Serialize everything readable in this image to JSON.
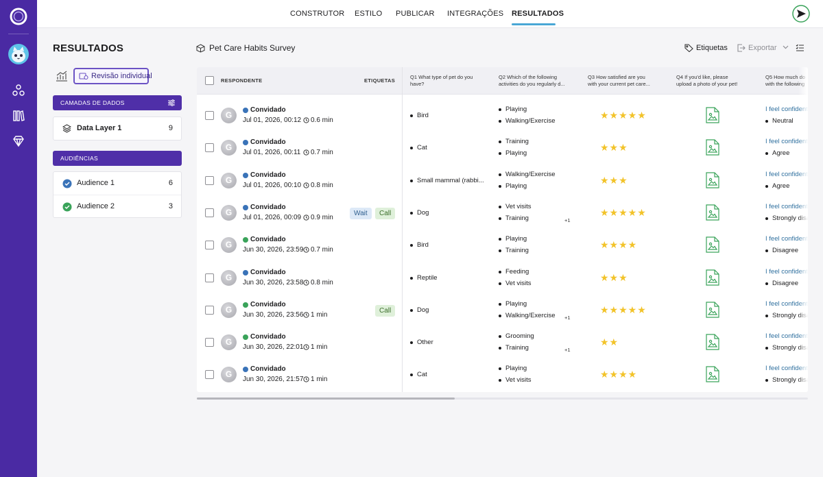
{
  "nav": {
    "tabs": [
      {
        "label": "CONSTRUTOR"
      },
      {
        "label": "ESTILO"
      },
      {
        "label": "PUBLICAR"
      },
      {
        "label": "INTEGRAÇÕES"
      },
      {
        "label": "RESULTADOS",
        "active": true
      }
    ]
  },
  "sidebar": {
    "title": "RESULTADOS",
    "review_button": "Revisão individual",
    "data_layers_header": "CAMADAS DE DADOS",
    "data_layers": [
      {
        "label": "Data Layer 1",
        "count": "9"
      }
    ],
    "audiences_header": "AUDIÊNCIAS",
    "audiences": [
      {
        "label": "Audience 1",
        "count": "6",
        "color": "#3a73b8"
      },
      {
        "label": "Audience 2",
        "count": "3",
        "color": "#3aa35a"
      }
    ]
  },
  "survey": {
    "title": "Pet Care Habits Survey"
  },
  "toolbar": {
    "tags_label": "Etiquetas",
    "export_label": "Exportar"
  },
  "table": {
    "headers": {
      "respondent": "RESPONDENTE",
      "tags": "ETIQUETAS",
      "q1": [
        "Q1 What type of pet do you",
        "have?"
      ],
      "q2": [
        "Q2 Which of the following",
        "activities do you regularly d..."
      ],
      "q3": [
        "Q3 How satisfied are you",
        "with your current pet care..."
      ],
      "q4": [
        "Q4 If you'd like, please",
        "upload a photo of your pet!"
      ],
      "q5": [
        "Q5 How much do",
        "with the following"
      ]
    },
    "rows": [
      {
        "name": "Convidado",
        "dot": "#3a73b8",
        "date": "Jul 01, 2026, 00:12",
        "time": "0.6 min",
        "tags": [],
        "q1": "Bird",
        "q2": [
          "Playing",
          "Walking/Exercise"
        ],
        "q2_more": "",
        "stars": 5,
        "q5_link": "I feel confident",
        "q5": "Neutral"
      },
      {
        "name": "Convidado",
        "dot": "#3a73b8",
        "date": "Jul 01, 2026, 00:11",
        "time": "0.7 min",
        "tags": [],
        "q1": "Cat",
        "q2": [
          "Training",
          "Playing"
        ],
        "q2_more": "",
        "stars": 3,
        "q5_link": "I feel confident",
        "q5": "Agree"
      },
      {
        "name": "Convidado",
        "dot": "#3a73b8",
        "date": "Jul 01, 2026, 00:10",
        "time": "0.8 min",
        "tags": [],
        "q1": "Small mammal (rabbi...",
        "q2": [
          "Walking/Exercise",
          "Playing"
        ],
        "q2_more": "",
        "stars": 3,
        "q5_link": "I feel confident",
        "q5": "Agree"
      },
      {
        "name": "Convidado",
        "dot": "#3a73b8",
        "date": "Jul 01, 2026, 00:09",
        "time": "0.9 min",
        "tags": [
          "Wait",
          "Call"
        ],
        "q1": "Dog",
        "q2": [
          "Vet visits",
          "Training"
        ],
        "q2_more": "+1",
        "stars": 5,
        "q5_link": "I feel confident",
        "q5": "Strongly disa"
      },
      {
        "name": "Convidado",
        "dot": "#3aa35a",
        "date": "Jun 30, 2026, 23:59",
        "time": "0.7 min",
        "tags": [],
        "q1": "Bird",
        "q2": [
          "Playing",
          "Training"
        ],
        "q2_more": "",
        "stars": 4,
        "q5_link": "I feel confident",
        "q5": "Disagree"
      },
      {
        "name": "Convidado",
        "dot": "#3a73b8",
        "date": "Jun 30, 2026, 23:58",
        "time": "0.8 min",
        "tags": [],
        "q1": "Reptile",
        "q2": [
          "Feeding",
          "Vet visits"
        ],
        "q2_more": "",
        "stars": 3,
        "q5_link": "I feel confident",
        "q5": "Disagree"
      },
      {
        "name": "Convidado",
        "dot": "#3aa35a",
        "date": "Jun 30, 2026, 23:56",
        "time": "1 min",
        "tags": [
          "Call"
        ],
        "q1": "Dog",
        "q2": [
          "Playing",
          "Walking/Exercise"
        ],
        "q2_more": "+1",
        "stars": 5,
        "q5_link": "I feel confident",
        "q5": "Strongly disa"
      },
      {
        "name": "Convidado",
        "dot": "#3aa35a",
        "date": "Jun 30, 2026, 22:01",
        "time": "1 min",
        "tags": [],
        "q1": "Other",
        "q2": [
          "Grooming",
          "Training"
        ],
        "q2_more": "+1",
        "stars": 2,
        "q5_link": "I feel confident",
        "q5": "Strongly disa"
      },
      {
        "name": "Convidado",
        "dot": "#3a73b8",
        "date": "Jun 30, 2026, 21:57",
        "time": "1 min",
        "tags": [],
        "q1": "Cat",
        "q2": [
          "Playing",
          "Vet visits"
        ],
        "q2_more": "",
        "stars": 4,
        "q5_link": "I feel confident",
        "q5": "Strongly disa"
      }
    ]
  },
  "colors": {
    "rail": "#4a2aa3",
    "accent": "#6b52c4",
    "tab_underline": "#49a7d6",
    "star": "#f2c32a",
    "image_icon": "#3aa35a"
  },
  "icons": {
    "logo": "ring-logo-icon",
    "avatar": "cat-avatar-icon",
    "nav": [
      "hierarchy-icon",
      "library-icon",
      "diamond-icon"
    ],
    "send": "send-icon"
  }
}
